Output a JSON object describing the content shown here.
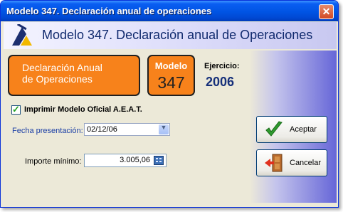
{
  "window": {
    "title": "Modelo 347. Declaración anual de operaciones"
  },
  "header": {
    "title": "Modelo 347. Declaración anual de Operaciones"
  },
  "summary": {
    "declaracion_line1": "Declaración Anual",
    "declaracion_line2": "de Operaciones",
    "modelo_label": "Modelo",
    "modelo_number": "347",
    "ejercicio_label": "Ejercicio:",
    "ejercicio_value": "2006"
  },
  "form": {
    "imprimir_label": "Imprimir Modelo Oficial A.E.A.T.",
    "imprimir_checked": true,
    "fecha_label": "Fecha presentación:",
    "fecha_value": "02/12/06",
    "importe_label": "Importe mínimo:",
    "importe_value": "3.005,06"
  },
  "buttons": {
    "accept_label": "Aceptar",
    "cancel_label": "Cancelar"
  },
  "colors": {
    "accent_orange": "#F7821B",
    "title_blue": "#0054E3",
    "ejercicio_blue": "#16307A",
    "link_blue": "#1A3EA5"
  }
}
